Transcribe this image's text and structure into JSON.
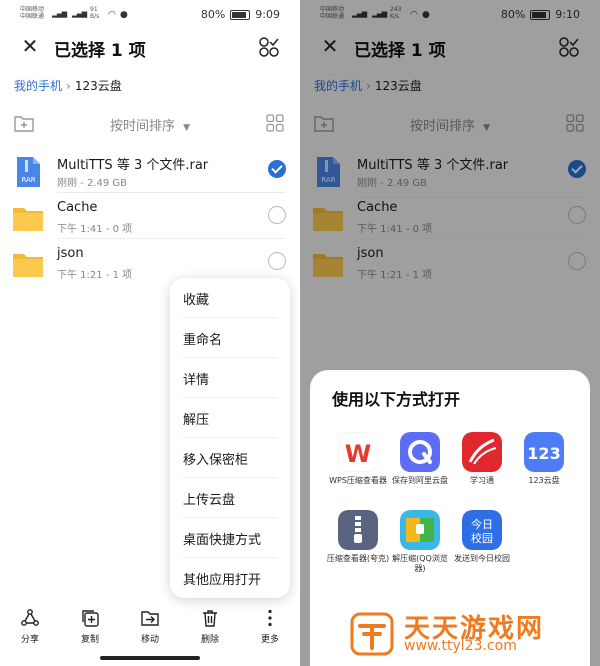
{
  "left": {
    "status": {
      "carrier1": "中国移动",
      "carrier2": "中国联通",
      "speed": "91",
      "speed_unit": "B/s",
      "battery": "80%",
      "time": "9:09"
    }
  },
  "right": {
    "status": {
      "carrier1": "中国移动",
      "carrier2": "中国联通",
      "speed": "243",
      "speed_unit": "K/s",
      "battery": "80%",
      "time": "9:10"
    }
  },
  "header": {
    "title": "已选择 1 项"
  },
  "breadcrumb": {
    "root": "我的手机",
    "current": "123云盘"
  },
  "toolbar": {
    "sort_label": "按时间排序"
  },
  "files": [
    {
      "name": "MultiTTS 等 3 个文件.rar",
      "meta": "刚刚 - 2.49 GB",
      "type": "rar",
      "selected": true
    },
    {
      "name": "Cache",
      "meta": "下午 1:41 - 0 项",
      "type": "folder",
      "selected": false
    },
    {
      "name": "json",
      "meta": "下午 1:21 - 1 项",
      "type": "folder",
      "selected": false
    }
  ],
  "rar_badge": "RAR",
  "context_menu": [
    "收藏",
    "重命名",
    "详情",
    "解压",
    "移入保密柜",
    "上传云盘",
    "桌面快捷方式",
    "其他应用打开"
  ],
  "bottom_bar": [
    "分享",
    "复制",
    "移动",
    "删除",
    "更多"
  ],
  "open_with": {
    "title": "使用以下方式打开",
    "apps": [
      {
        "label": "WPS压缩查看器",
        "icon": "wps-icon",
        "color": "#ffffff"
      },
      {
        "label": "保存到阿里云盘",
        "icon": "aliyun-drive-icon",
        "color": "#5b6ef5"
      },
      {
        "label": "学习通",
        "icon": "xuexitong-icon",
        "color": "#e0282e"
      },
      {
        "label": "123云盘",
        "icon": "123pan-icon",
        "color": "#4d7cf4"
      },
      {
        "label": "压缩查看器(夸克)",
        "icon": "quark-zip-icon",
        "color": "#5a6380"
      },
      {
        "label": "解压缩(QQ浏览器)",
        "icon": "qq-zip-icon",
        "color": "#3ab8e8"
      },
      {
        "label": "发送到今日校园",
        "icon": "jinrixiaoyuan-icon",
        "color": "#2f6fe6"
      }
    ],
    "app_badges": {
      "wps": "W",
      "pan123": "123",
      "jrxy_line1": "今日",
      "jrxy_line2": "校园"
    }
  },
  "watermark": {
    "title": "天天游戏网",
    "url": "www.ttyl23.com"
  },
  "colors": {
    "accent": "#2a6fd6",
    "folder": "#f5b93a",
    "watermark": "#f07a1d"
  }
}
